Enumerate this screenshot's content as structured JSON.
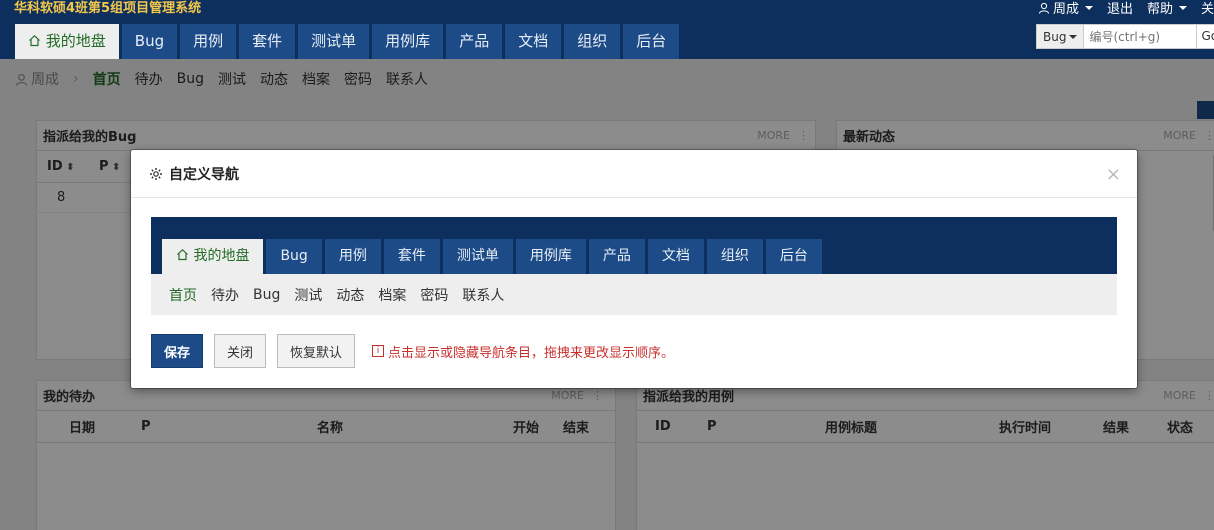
{
  "header": {
    "system_title": "华科软硕4班第5组项目管理系统",
    "user_menu": "周成",
    "logout": "退出",
    "help": "帮助"
  },
  "main_nav": [
    "我的地盘",
    "Bug",
    "用例",
    "套件",
    "测试单",
    "用例库",
    "产品",
    "文档",
    "组织",
    "后台"
  ],
  "search": {
    "type": "Bug",
    "placeholder": "编号(ctrl+g)",
    "go": "Go"
  },
  "breadcrumb_user": "周成",
  "sub_nav": [
    "首页",
    "待办",
    "Bug",
    "测试",
    "动态",
    "档案",
    "密码",
    "联系人"
  ],
  "panels": {
    "bugs": {
      "title": "指派给我的Bug",
      "more": "MORE",
      "columns": [
        "ID",
        "P"
      ],
      "rows": [
        {
          "id": "8"
        }
      ]
    },
    "dynamics": {
      "title": "最新动态",
      "more": "MORE"
    },
    "todos": {
      "title": "我的待办",
      "more": "MORE",
      "columns": [
        "日期",
        "P",
        "名称",
        "开始",
        "结束"
      ]
    },
    "cases": {
      "title": "指派给我的用例",
      "more": "MORE",
      "columns": [
        "ID",
        "P",
        "用例标题",
        "执行时间",
        "结果",
        "状态"
      ]
    }
  },
  "modal": {
    "title": "自定义导航",
    "close": "×",
    "preview_nav": [
      "我的地盘",
      "Bug",
      "用例",
      "套件",
      "测试单",
      "用例库",
      "产品",
      "文档",
      "组织",
      "后台"
    ],
    "preview_sub": [
      "首页",
      "待办",
      "Bug",
      "测试",
      "动态",
      "档案",
      "密码",
      "联系人"
    ],
    "save": "保存",
    "cancel": "关闭",
    "reset": "恢复默认",
    "hint": "点击显示或隐藏导航条目，拖拽来更改显示顺序。"
  }
}
